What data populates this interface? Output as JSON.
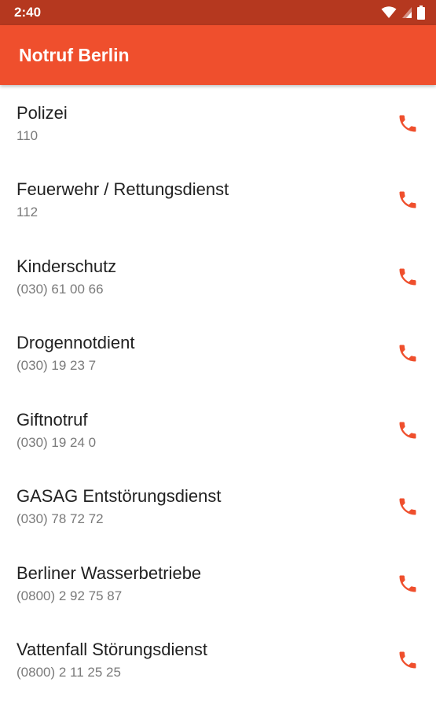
{
  "status_bar": {
    "time": "2:40",
    "icons": [
      "wifi-icon",
      "cell-signal-icon",
      "battery-icon"
    ]
  },
  "app_bar": {
    "title": "Notruf Berlin"
  },
  "colors": {
    "status_bar": "#b5381f",
    "app_bar": "#ef4f2d",
    "accent": "#ef4f2d",
    "secondary_text": "#7a7a7a"
  },
  "contacts": [
    {
      "name": "Polizei",
      "number": "110",
      "action_icon": "phone-icon"
    },
    {
      "name": "Feuerwehr / Rettungsdienst",
      "number": "112",
      "action_icon": "phone-icon"
    },
    {
      "name": "Kinderschutz",
      "number": "(030) 61 00 66",
      "action_icon": "phone-icon"
    },
    {
      "name": "Drogennotdient",
      "number": "(030) 19 23 7",
      "action_icon": "phone-icon"
    },
    {
      "name": "Giftnotruf",
      "number": "(030) 19 24 0",
      "action_icon": "phone-icon"
    },
    {
      "name": "GASAG Entstörungsdienst",
      "number": "(030) 78 72 72",
      "action_icon": "phone-icon"
    },
    {
      "name": "Berliner Wasserbetriebe",
      "number": "(0800) 2 92 75 87",
      "action_icon": "phone-icon"
    },
    {
      "name": "Vattenfall Störungsdienst",
      "number": "(0800) 2 11 25 25",
      "action_icon": "phone-icon"
    }
  ]
}
